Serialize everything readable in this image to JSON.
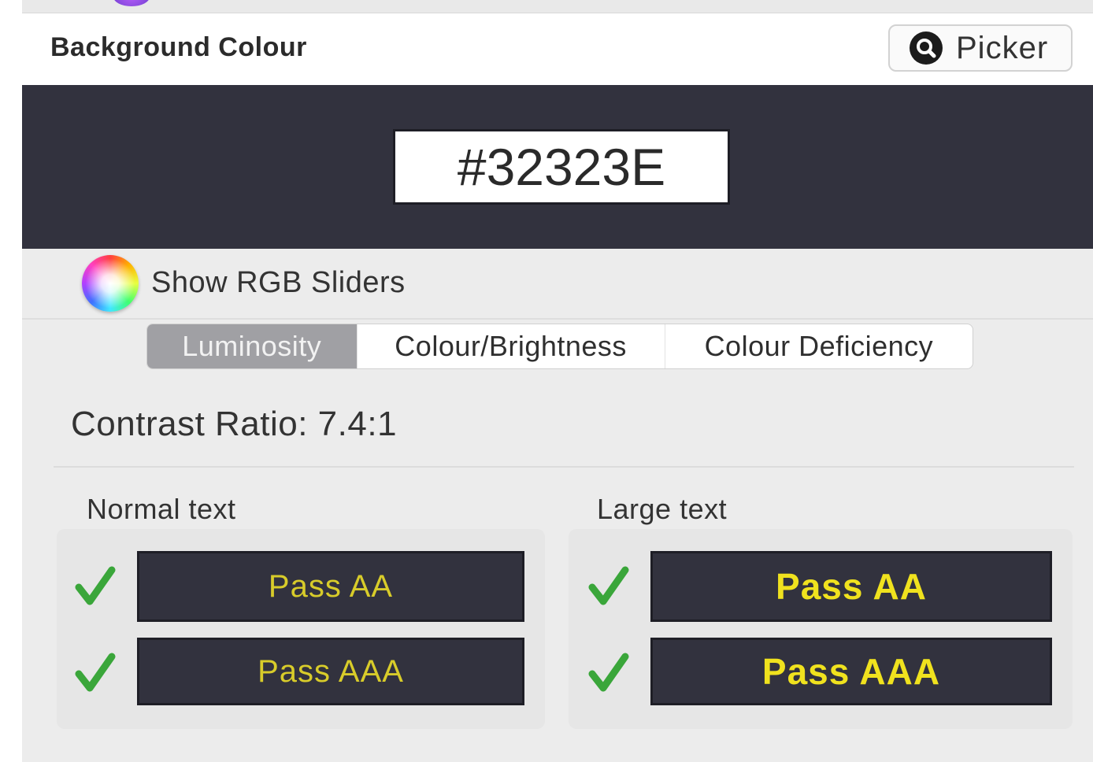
{
  "header": {
    "title": "Background Colour",
    "picker_label": "Picker"
  },
  "swatch": {
    "hex_value": "#32323E",
    "color": "#32323e"
  },
  "rgb": {
    "label": "Show RGB Sliders"
  },
  "tabs": [
    {
      "label": "Luminosity",
      "active": true
    },
    {
      "label": "Colour/Brightness",
      "active": false
    },
    {
      "label": "Colour Deficiency",
      "active": false
    }
  ],
  "contrast": {
    "text": "Contrast Ratio: 7.4:1"
  },
  "results": {
    "normal": {
      "label": "Normal text",
      "aa": "Pass AA",
      "aaa": "Pass AAA"
    },
    "large": {
      "label": "Large text",
      "aa": "Pass AA",
      "aaa": "Pass AAA"
    }
  },
  "colors": {
    "background_swatch": "#32323e",
    "pass_text": "#e8dc24",
    "check_green": "#3aa63a"
  },
  "icons": {
    "picker": "magnifier-icon",
    "rgb": "color-wheel-icon",
    "pass": "checkmark-icon"
  }
}
